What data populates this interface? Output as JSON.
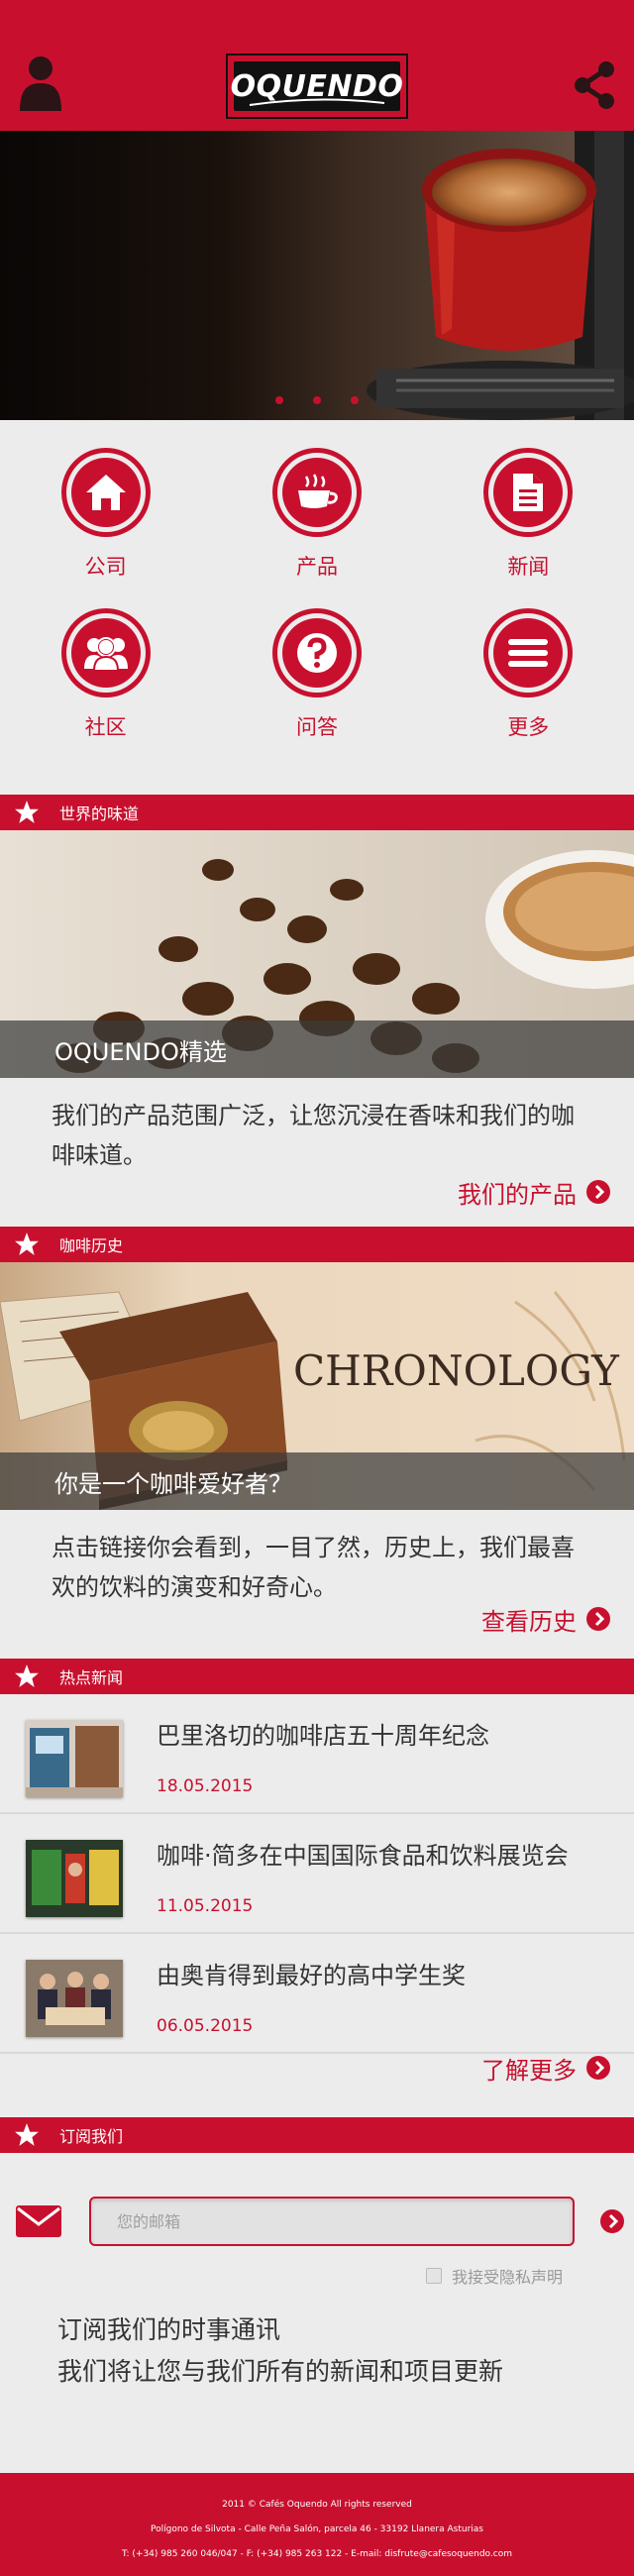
{
  "header": {
    "logo_text": "OQUENDO",
    "user_icon": "user-icon",
    "share_icon": "share-icon",
    "colors": {
      "brand": "#c8102e"
    }
  },
  "hero": {
    "dots": 3
  },
  "nav_grid": [
    {
      "label": "公司",
      "icon": "home-icon"
    },
    {
      "label": "产品",
      "icon": "coffee-cup-icon"
    },
    {
      "label": "新闻",
      "icon": "document-icon"
    },
    {
      "label": "社区",
      "icon": "people-icon"
    },
    {
      "label": "问答",
      "icon": "question-icon"
    },
    {
      "label": "更多",
      "icon": "menu-icon"
    }
  ],
  "sections": {
    "taste": {
      "bar_title": "世界的味道",
      "caption": "OQUENDO精选",
      "text": "我们的产品范围广泛，让您沉浸在香味和我们的咖啡味道。",
      "link": "我们的产品"
    },
    "history": {
      "bar_title": "咖啡历史",
      "image_word": "CHRONOLOGY",
      "caption": "你是一个咖啡爱好者？",
      "text": "点击链接你会看到，一目了然，历史上，我们最喜欢的饮料的演变和好奇心。",
      "link": "查看历史"
    },
    "news": {
      "bar_title": "热点新闻",
      "items": [
        {
          "title": "巴里洛切的咖啡店五十周年纪念",
          "date": "18.05.2015"
        },
        {
          "title": "咖啡·简多在中国国际食品和饮料展览会",
          "date": "11.05.2015"
        },
        {
          "title": "由奥肯得到最好的高中学生奖",
          "date": "06.05.2015"
        }
      ],
      "link": "了解更多"
    },
    "subscribe": {
      "bar_title": "订阅我们",
      "placeholder": "您的邮箱",
      "privacy": "我接受隐私声明",
      "line1": "订阅我们的时事通讯",
      "line2": "我们将让您与我们所有的新闻和项目更新"
    }
  },
  "footer": {
    "line1": "2011 © Cafés Oquendo All rights reserved",
    "line2": "Polígono de Silvota - Calle Peña Salón, parcela 46 - 33192 Llanera Asturias",
    "line3": "T: (+34) 985 260 046/047 - F: (+34) 985 263 122 - E-mail: disfrute@cafesoquendo.com"
  }
}
